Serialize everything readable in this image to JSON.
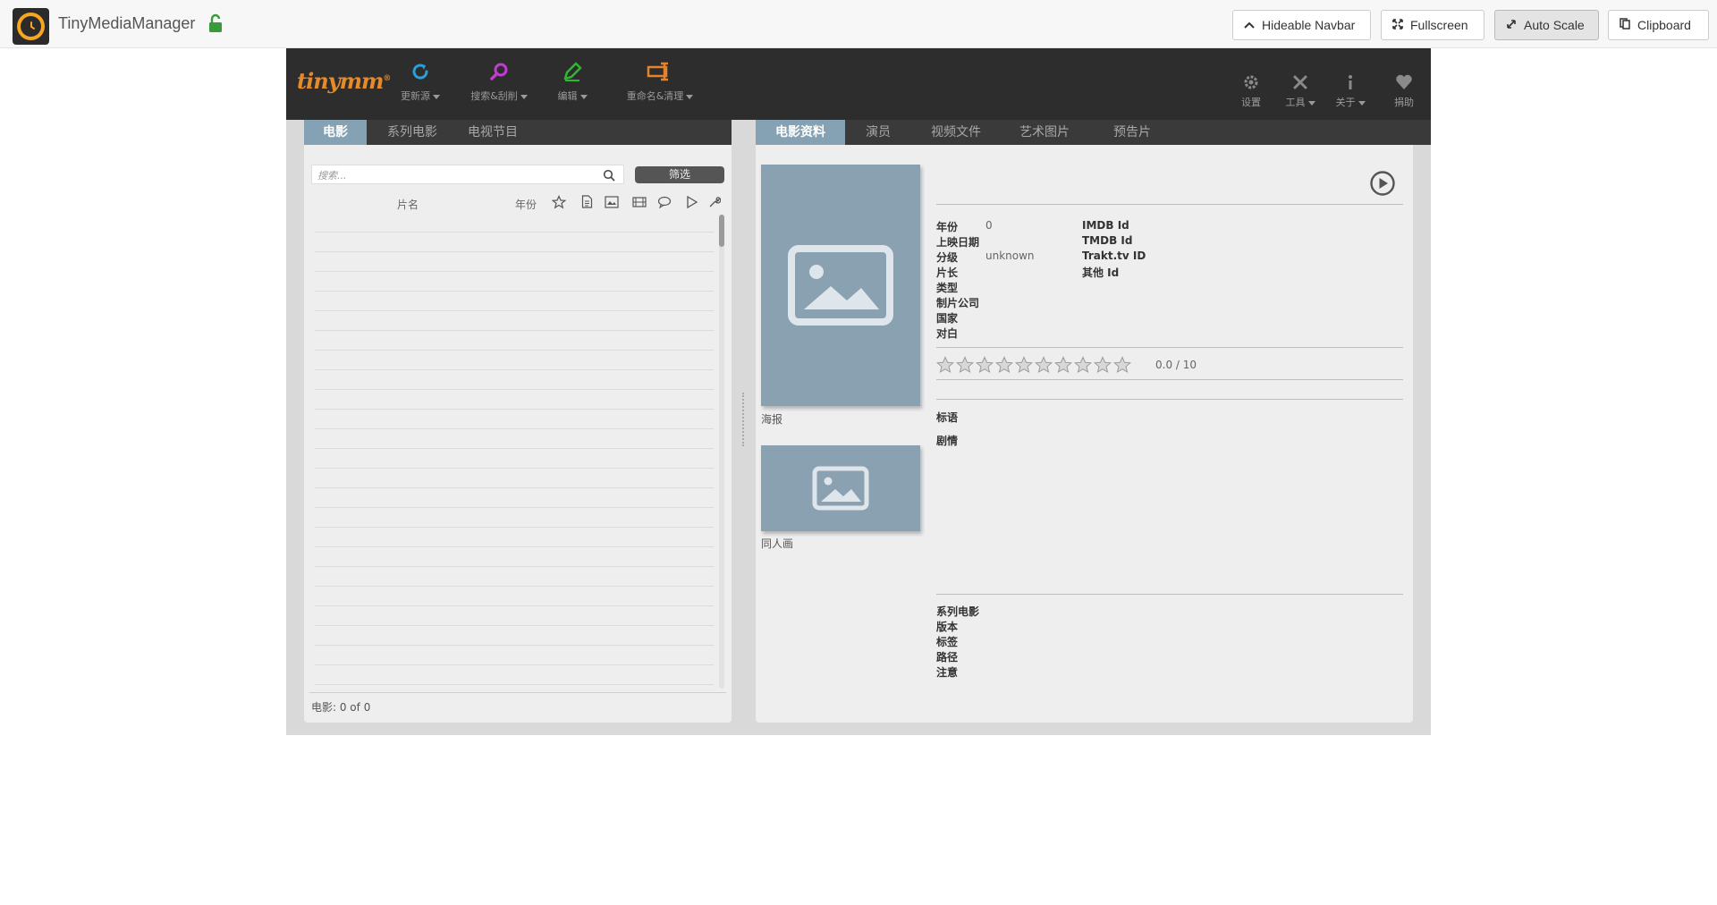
{
  "host": {
    "title": "TinyMediaManager",
    "buttons": {
      "hideable_navbar": "Hideable Navbar",
      "fullscreen": "Fullscreen",
      "auto_scale": "Auto Scale",
      "clipboard": "Clipboard"
    }
  },
  "brand": "tinymm",
  "toolbar": {
    "update_sources": "更新源",
    "search_scrape": "搜索&刮削",
    "edit": "编辑",
    "rename_clean": "重命名&清理",
    "settings": "设置",
    "tools": "工具",
    "about": "关于",
    "donate": "捐助"
  },
  "left_tabs": [
    "电影",
    "系列电影",
    "电视节目"
  ],
  "right_tabs": [
    "电影资料",
    "演员",
    "视频文件",
    "艺术图片",
    "预告片"
  ],
  "movie_list": {
    "search_placeholder": "搜索...",
    "filter_button": "筛选",
    "col_title": "片名",
    "col_year": "年份",
    "footer": "电影:  0  of  0"
  },
  "details": {
    "poster_caption": "海报",
    "fanart_caption": "同人画",
    "year_label": "年份",
    "year_value": "0",
    "release_label": "上映日期",
    "certification_label": "分级",
    "certification_value": "unknown",
    "runtime_label": "片长",
    "genre_label": "类型",
    "studio_label": "制片公司",
    "country_label": "国家",
    "spoken_label": "对白",
    "imdb_label": "IMDB Id",
    "tmdb_label": "TMDB Id",
    "trakt_label": "Trakt.tv ID",
    "other_id_label": "其他 Id",
    "rating_text": "0.0 / 10",
    "rating_value": 0,
    "rating_max": 10,
    "tagline_label": "标语",
    "plot_label": "剧情",
    "movieset_label": "系列电影",
    "edition_label": "版本",
    "tags_label": "标签",
    "path_label": "路径",
    "note_label": "注意"
  },
  "colors": {
    "accent": "#84a2b4",
    "toolbar_bg": "#2d2d2d",
    "brand": "#e58b2a",
    "update_icon": "#2aa0d8",
    "search_icon": "#c23bd4",
    "edit_icon": "#2db82d",
    "rename_icon": "#e5822a"
  }
}
